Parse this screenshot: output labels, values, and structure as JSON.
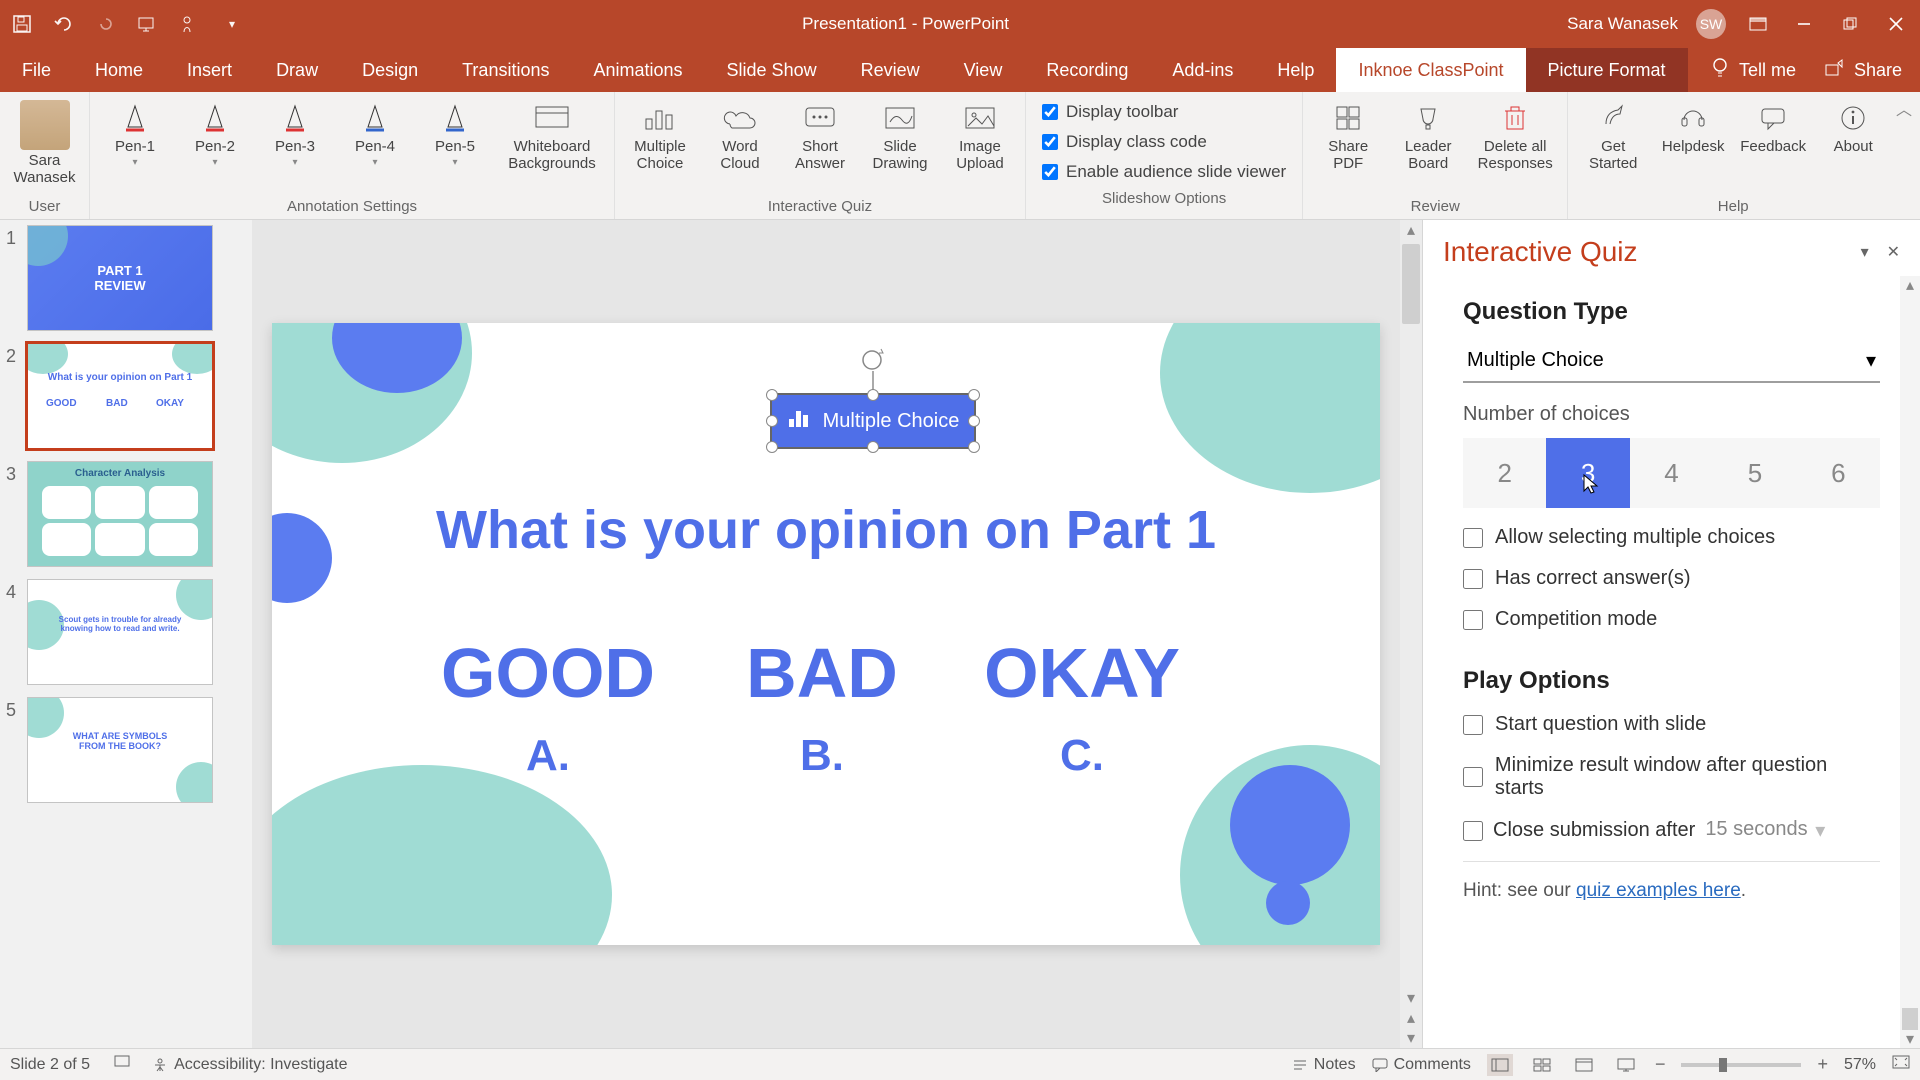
{
  "titlebar": {
    "title": "Presentation1 - PowerPoint",
    "user_name": "Sara Wanasek",
    "user_initials": "SW"
  },
  "tabs": {
    "file": "File",
    "home": "Home",
    "insert": "Insert",
    "draw": "Draw",
    "design": "Design",
    "transitions": "Transitions",
    "animations": "Animations",
    "slideshow": "Slide Show",
    "review": "Review",
    "view": "View",
    "recording": "Recording",
    "addins": "Add-ins",
    "help": "Help",
    "classpoint": "Inknoe ClassPoint",
    "picturefmt": "Picture Format",
    "tellme": "Tell me",
    "share": "Share"
  },
  "ribbon": {
    "user_group": "User",
    "user_name_line1": "Sara",
    "user_name_line2": "Wanasek",
    "pen1": "Pen-1",
    "pen2": "Pen-2",
    "pen3": "Pen-3",
    "pen4": "Pen-4",
    "pen5": "Pen-5",
    "whiteboard": "Whiteboard\nBackgrounds",
    "annotation_group": "Annotation Settings",
    "mc": "Multiple\nChoice",
    "wc": "Word\nCloud",
    "sa": "Short\nAnswer",
    "sd": "Slide\nDrawing",
    "iu": "Image\nUpload",
    "quiz_group": "Interactive Quiz",
    "opt1": "Display toolbar",
    "opt2": "Display class code",
    "opt3": "Enable audience slide viewer",
    "slideshow_group": "Slideshow Options",
    "share_pdf": "Share\nPDF",
    "leader": "Leader\nBoard",
    "delete": "Delete all\nResponses",
    "review_group": "Review",
    "getstarted": "Get\nStarted",
    "helpdesk": "Helpdesk",
    "feedback": "Feedback",
    "about": "About",
    "help_group": "Help"
  },
  "thumbs": {
    "n1": "1",
    "n2": "2",
    "n3": "3",
    "n4": "4",
    "n5": "5",
    "t1_line1": "PART 1",
    "t1_line2": "REVIEW",
    "t2_q": "What is your opinion on Part 1",
    "t2_a": "GOOD",
    "t2_b": "BAD",
    "t2_c": "OKAY",
    "t3_title": "Character Analysis",
    "t4_text": "Scout gets in trouble for already knowing how to read and write.",
    "t5_line1": "WHAT ARE SYMBOLS",
    "t5_line2": "FROM THE BOOK?"
  },
  "slide": {
    "mc_label": "Multiple Choice",
    "question": "What is your opinion on Part 1",
    "ans1": "GOOD",
    "ans1_l": "A.",
    "ans2": "BAD",
    "ans2_l": "B.",
    "ans3": "OKAY",
    "ans3_l": "C."
  },
  "panel": {
    "title": "Interactive Quiz",
    "qtype_label": "Question Type",
    "qtype_value": "Multiple Choice",
    "numchoices_label": "Number of choices",
    "n2": "2",
    "n3": "3",
    "n4": "4",
    "n5": "5",
    "n6": "6",
    "chk_multi": "Allow selecting multiple choices",
    "chk_correct": "Has correct answer(s)",
    "chk_comp": "Competition mode",
    "play_label": "Play Options",
    "chk_start": "Start question with slide",
    "chk_min": "Minimize result window after question starts",
    "chk_close": "Close submission after",
    "close_timer": "15 seconds",
    "hint_prefix": "Hint: see our ",
    "hint_link": "quiz examples here"
  },
  "status": {
    "slide": "Slide 2 of 5",
    "accessibility": "Accessibility: Investigate",
    "notes": "Notes",
    "comments": "Comments",
    "zoom": "57%"
  }
}
